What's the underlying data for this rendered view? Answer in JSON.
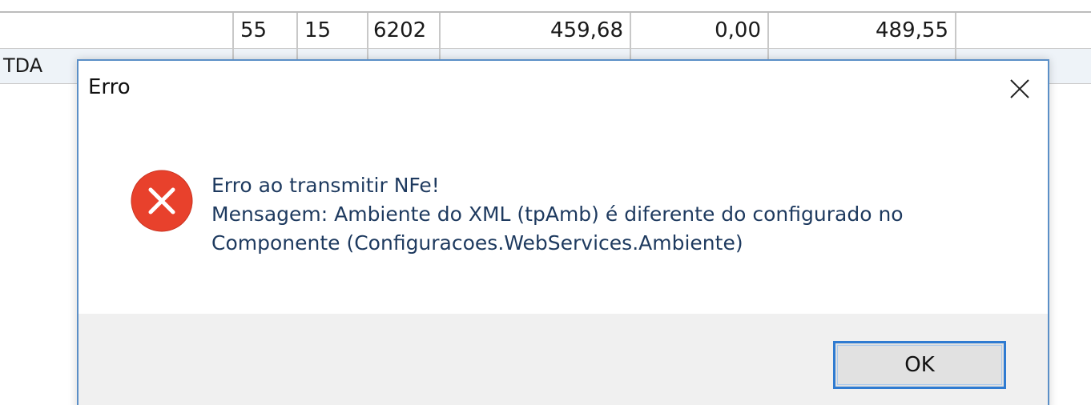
{
  "table": {
    "row1": {
      "col_a": "55",
      "col_b": "15",
      "col_c": "6202",
      "col_d": "459,68",
      "col_e": "0,00",
      "col_f": "489,55"
    },
    "row2": {
      "name_partial": "TDA"
    }
  },
  "dialog": {
    "title": "Erro",
    "close_icon": "close-icon",
    "error_icon": "error-icon",
    "message_line1": "Erro ao transmitir NFe!",
    "message_line2": "Mensagem: Ambiente do XML (tpAmb) é diferente do configurado no",
    "message_line3": "Componente (Configuracoes.WebServices.Ambiente)",
    "ok_label": "OK",
    "colors": {
      "error_red": "#e8412c",
      "accent_blue": "#2f7bd1",
      "footer_bg": "#f0f0f0"
    }
  }
}
